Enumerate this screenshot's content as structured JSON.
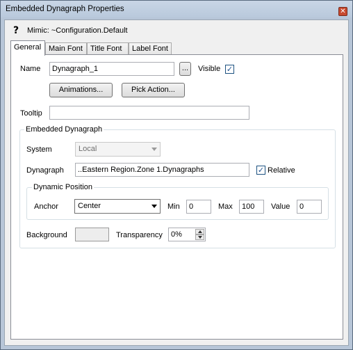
{
  "window": {
    "title": "Embedded Dynagraph Properties",
    "close_icon": "close-icon",
    "close_glyph": "✕"
  },
  "header": {
    "help_icon": "question-icon",
    "help_glyph": "?",
    "mimic_text": "Mimic: ~Configuration.Default"
  },
  "tabs": [
    {
      "label": "General",
      "active": true
    },
    {
      "label": "Main Font",
      "active": false
    },
    {
      "label": "Title Font",
      "active": false
    },
    {
      "label": "Label Font",
      "active": false
    }
  ],
  "general": {
    "name_label": "Name",
    "name_value": "Dynagraph_1",
    "browse_label": "...",
    "visible_label": "Visible",
    "visible_checked": true,
    "check_glyph": "✓",
    "animations_label": "Animations...",
    "pick_action_label": "Pick Action...",
    "tooltip_label": "Tooltip",
    "tooltip_value": ""
  },
  "embedded": {
    "group_title": "Embedded Dynagraph",
    "system_label": "System",
    "system_value": "Local",
    "dynagraph_label": "Dynagraph",
    "dynagraph_value": "..Eastern Region.Zone 1.Dynagraphs",
    "relative_label": "Relative",
    "relative_checked": true,
    "dynamic_position": {
      "group_title": "Dynamic Position",
      "anchor_label": "Anchor",
      "anchor_value": "Center",
      "min_label": "Min",
      "min_value": "0",
      "max_label": "Max",
      "max_value": "100",
      "value_label": "Value",
      "value_value": "0"
    },
    "background_label": "Background",
    "background_color": "#ededed",
    "transparency_label": "Transparency",
    "transparency_value": "0%"
  }
}
